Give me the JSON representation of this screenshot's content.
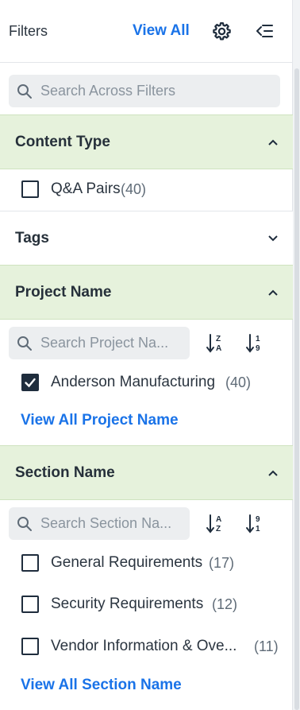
{
  "header": {
    "title": "Filters",
    "view_all_label": "View All",
    "settings_icon": "gear-icon",
    "collapse_icon": "collapse-left-icon"
  },
  "search": {
    "placeholder": "Search Across Filters"
  },
  "sections": {
    "content_type": {
      "title": "Content Type",
      "expanded": true,
      "options": [
        {
          "label": "Q&A Pairs",
          "count": "(40)",
          "checked": false
        }
      ]
    },
    "tags": {
      "title": "Tags",
      "expanded": false
    },
    "project_name": {
      "title": "Project Name",
      "expanded": true,
      "search_placeholder": "Search Project Na...",
      "options": [
        {
          "label": "Anderson Manufacturing",
          "count": "(40)",
          "checked": true
        }
      ],
      "view_all_label": "View All Project Name"
    },
    "section_name": {
      "title": "Section Name",
      "expanded": true,
      "search_placeholder": "Search Section Na...",
      "options": [
        {
          "label": "General Requirements",
          "count": "(17)",
          "checked": false
        },
        {
          "label": "Security Requirements",
          "count": "(12)",
          "checked": false
        },
        {
          "label": "Vendor Information & Ove...",
          "count": "(11)",
          "checked": false
        }
      ],
      "view_all_label": "View All Section Name"
    }
  },
  "colors": {
    "accent": "#1a73e8",
    "section_bg": "#e6f2dc",
    "text": "#2b3540"
  }
}
